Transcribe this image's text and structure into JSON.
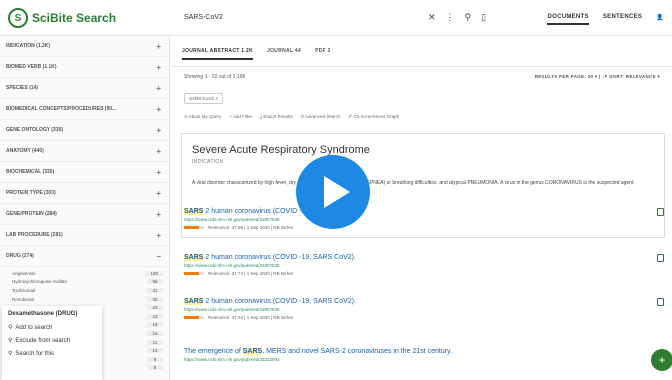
{
  "app": {
    "name": "SciBite Search",
    "logo_glyph": "S"
  },
  "search": {
    "value": "SARS-CoV2",
    "clear_icon": "close-icon",
    "menu_icon": "more-vert-icon",
    "search_icon": "search-icon",
    "bookmark_icon": "bookmark-icon"
  },
  "topnav": {
    "documents": "DOCUMENTS",
    "sentences": "SENTENCES",
    "user_icon": "person-icon"
  },
  "sidebar": {
    "facets": [
      {
        "label": "INDICATION (1.2K)",
        "toggle": "+"
      },
      {
        "label": "BIOMED VERB (1.1K)",
        "toggle": "+"
      },
      {
        "label": "SPECIES (14)",
        "toggle": "+"
      },
      {
        "label": "BIOMEDICAL CONCEPTS/PROCEDURES (90...",
        "toggle": "+"
      },
      {
        "label": "GENE ONTOLOGY (339)",
        "toggle": "+"
      },
      {
        "label": "ANATOMY (440)",
        "toggle": "+"
      },
      {
        "label": "BIOCHEMICAL (335)",
        "toggle": "+"
      },
      {
        "label": "PROTEIN TYPE (303)",
        "toggle": "+"
      },
      {
        "label": "GENE/PROTEIN (284)",
        "toggle": "+"
      },
      {
        "label": "LAB PROCEDURE (281)",
        "toggle": "+"
      },
      {
        "label": "DRUG (274)",
        "toggle": "−"
      }
    ],
    "drugs": [
      {
        "name": "Angiotensin",
        "count": "100"
      },
      {
        "name": "Hydroxychloroquine Sulfate",
        "count": "58"
      },
      {
        "name": "Tocilizumab",
        "count": "31"
      },
      {
        "name": "Remdesivir",
        "count": "30"
      },
      {
        "name": "Lopinavir",
        "count": "24"
      },
      {
        "name": "Chloroquine",
        "count": "23"
      },
      {
        "name": "Papain",
        "count": "18"
      },
      {
        "name": "",
        "count": "16"
      },
      {
        "name": "",
        "count": "11"
      },
      {
        "name": "",
        "count": "10"
      },
      {
        "name": "",
        "count": "9"
      },
      {
        "name": "",
        "count": "8"
      }
    ],
    "context_menu": {
      "header": "Dexamethasone (DRUG)",
      "add": "Add to search",
      "exclude": "Exclude from search",
      "search_for": "Search for this"
    }
  },
  "main": {
    "tabs": [
      "JOURNAL ABSTRACT 1.2K",
      "JOURNAL 44",
      "PDF 2"
    ],
    "showing": "Showing 1 - 20 out of 1,168",
    "results_per_page": "RESULTS PER PAGE: 20 ▾ | ↓F SORT: RELEVANCE ▾",
    "chip": "SARS-CoV2 ×",
    "actions": [
      "⊙ About My Query",
      "+ Add Filter",
      "⤓ Export Results",
      "⚲ Advanced Search",
      "✐ Co-occurrences Graph"
    ],
    "definition": {
      "title": "Severe Acute Respiratory Syndrome",
      "subtitle": "INDICATION",
      "body": "A viral disorder characterized by high fever, dry cough, shortness of breath (DYSPNEA) or breathing difficulties, and atypical PNEUMONIA. A virus in the genus CORONAVIRUS is the suspected agent."
    },
    "results": [
      {
        "title_pre": "",
        "title_hl": "SARS",
        "title_post": " 2 human coronavirus (COVID -19, SARS CoV2).",
        "url": "https://www.ncbi.nlm.nih.gov/pubmed/32807536",
        "meta": "Relevance: 37.99 | 1 Sep 2020 | RB Mcfee"
      },
      {
        "title_pre": "",
        "title_hl": "SARS",
        "title_post": " 2 human coronavirus (COVID -19, SARS CoV2).",
        "url": "https://www.ncbi.nlm.nih.gov/pubmed/32807536",
        "meta": "Relevance: 37.74 | 1 Sep 2020 | RB Mcfee"
      },
      {
        "title_pre": "",
        "title_hl": "SARS",
        "title_post": " 2 human coronavirus (COVID -19, SARS CoV2).",
        "url": "https://www.ncbi.nlm.nih.gov/pubmed/32807536",
        "meta": "Relevance: 37.34 | 1 Sep 2020 | RB Mcfee"
      },
      {
        "title_pre": "The emergence of ",
        "title_hl": "SARS",
        "title_post": ", MERS and novel SARS-2 coronaviruses in the 21st century.",
        "url": "https://www.ncbi.nlm.nih.gov/pubmed/32322993",
        "meta": ""
      }
    ]
  },
  "overlay": {
    "play_icon": "play-icon",
    "fab_icon": "plus-icon",
    "fab_label": "+"
  },
  "colors": {
    "brand": "#2e7d32",
    "link": "#1a5fb4",
    "play": "#1e88e5",
    "relevance": "#f57c00"
  }
}
